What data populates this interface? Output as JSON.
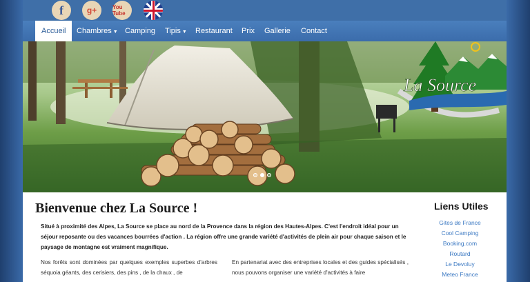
{
  "social": {
    "facebook": "facebook-icon",
    "googleplus": "google-plus-icon",
    "youtube": "youtube-icon",
    "language": "uk-flag-icon",
    "facebook_glyph": "f",
    "googleplus_glyph": "g+",
    "youtube_glyph": "You Tube"
  },
  "nav": {
    "items": [
      {
        "label": "Accueil",
        "active": true
      },
      {
        "label": "Chambres",
        "dropdown": true
      },
      {
        "label": "Camping"
      },
      {
        "label": "Tipis",
        "dropdown": true
      },
      {
        "label": "Restaurant"
      },
      {
        "label": "Prix"
      },
      {
        "label": "Gallerie"
      },
      {
        "label": "Contact"
      }
    ]
  },
  "hero": {
    "logo_text": "La Source",
    "slide_count": 3,
    "active_slide": 2
  },
  "main": {
    "title": "Bienvenue chez La Source !",
    "intro": "Situé à proximité des Alpes, La Source se place au nord de la Provence dans la région des Hautes-Alpes. C'est l'endroit idéal pour un séjour reposante ou des vacances bourrées d'action . La région offre une grande variété d'activités de plein air pour chaque saison et le paysage de montagne est vraiment magnifique.",
    "col_left": "Nos forêts sont dominées par quelques exemples superbes d'arbres séquoia géants, des cerisiers, des pins , de la chaux , de",
    "col_right": "En partenariat avec des entreprises locales et des guides spécialisés , nous pouvons organiser une variété d'activités à faire"
  },
  "sidebar": {
    "title": "Liens Utiles",
    "links": [
      "Gites de France",
      "Cool Camping",
      "Booking.com",
      "Routard",
      "Le Devoluy",
      "Meteo France"
    ]
  },
  "colors": {
    "nav": "#3b6cab",
    "link": "#3a78c2",
    "background": "#2f5f9a"
  }
}
